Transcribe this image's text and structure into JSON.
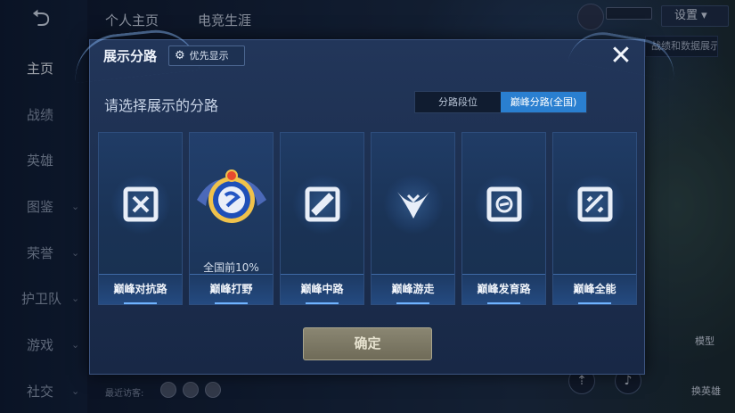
{
  "app": {
    "back_icon": "back-arrow-icon",
    "top_tabs": [
      "个人主页",
      "电竞生涯"
    ],
    "settings_label": "设置",
    "data_button_label": "战绩和数据展示"
  },
  "sidebar": {
    "items": [
      {
        "label": "主页",
        "active": true
      },
      {
        "label": "战绩"
      },
      {
        "label": "英雄"
      },
      {
        "label": "图鉴"
      },
      {
        "label": "荣誉"
      },
      {
        "label": "护卫队"
      },
      {
        "label": "游戏"
      },
      {
        "label": "社交"
      }
    ]
  },
  "bottom": {
    "visitors_label": "最近访客:",
    "model_label": "模型",
    "change_hero_label": "换英雄"
  },
  "modal": {
    "title": "展示分路",
    "priority_label": "优先显示",
    "close_icon": "close-icon",
    "prompt": "请选择展示的分路",
    "segments": [
      {
        "label": "分路段位",
        "active": false
      },
      {
        "label": "巅峰分路(全国)",
        "active": true
      }
    ],
    "cards": [
      {
        "label": "巅峰对抗路",
        "icon": "clash-lane-icon"
      },
      {
        "label": "巅峰打野",
        "icon": "jungle-rank-emblem",
        "rank_text": "全国前10%"
      },
      {
        "label": "巅峰中路",
        "icon": "mid-lane-icon"
      },
      {
        "label": "巅峰游走",
        "icon": "roam-icon"
      },
      {
        "label": "巅峰发育路",
        "icon": "farm-lane-icon"
      },
      {
        "label": "巅峰全能",
        "icon": "all-round-icon"
      }
    ],
    "confirm_label": "确定"
  },
  "colors": {
    "accent": "#2a7fd0",
    "confirm_disabled": "#7d7965"
  }
}
